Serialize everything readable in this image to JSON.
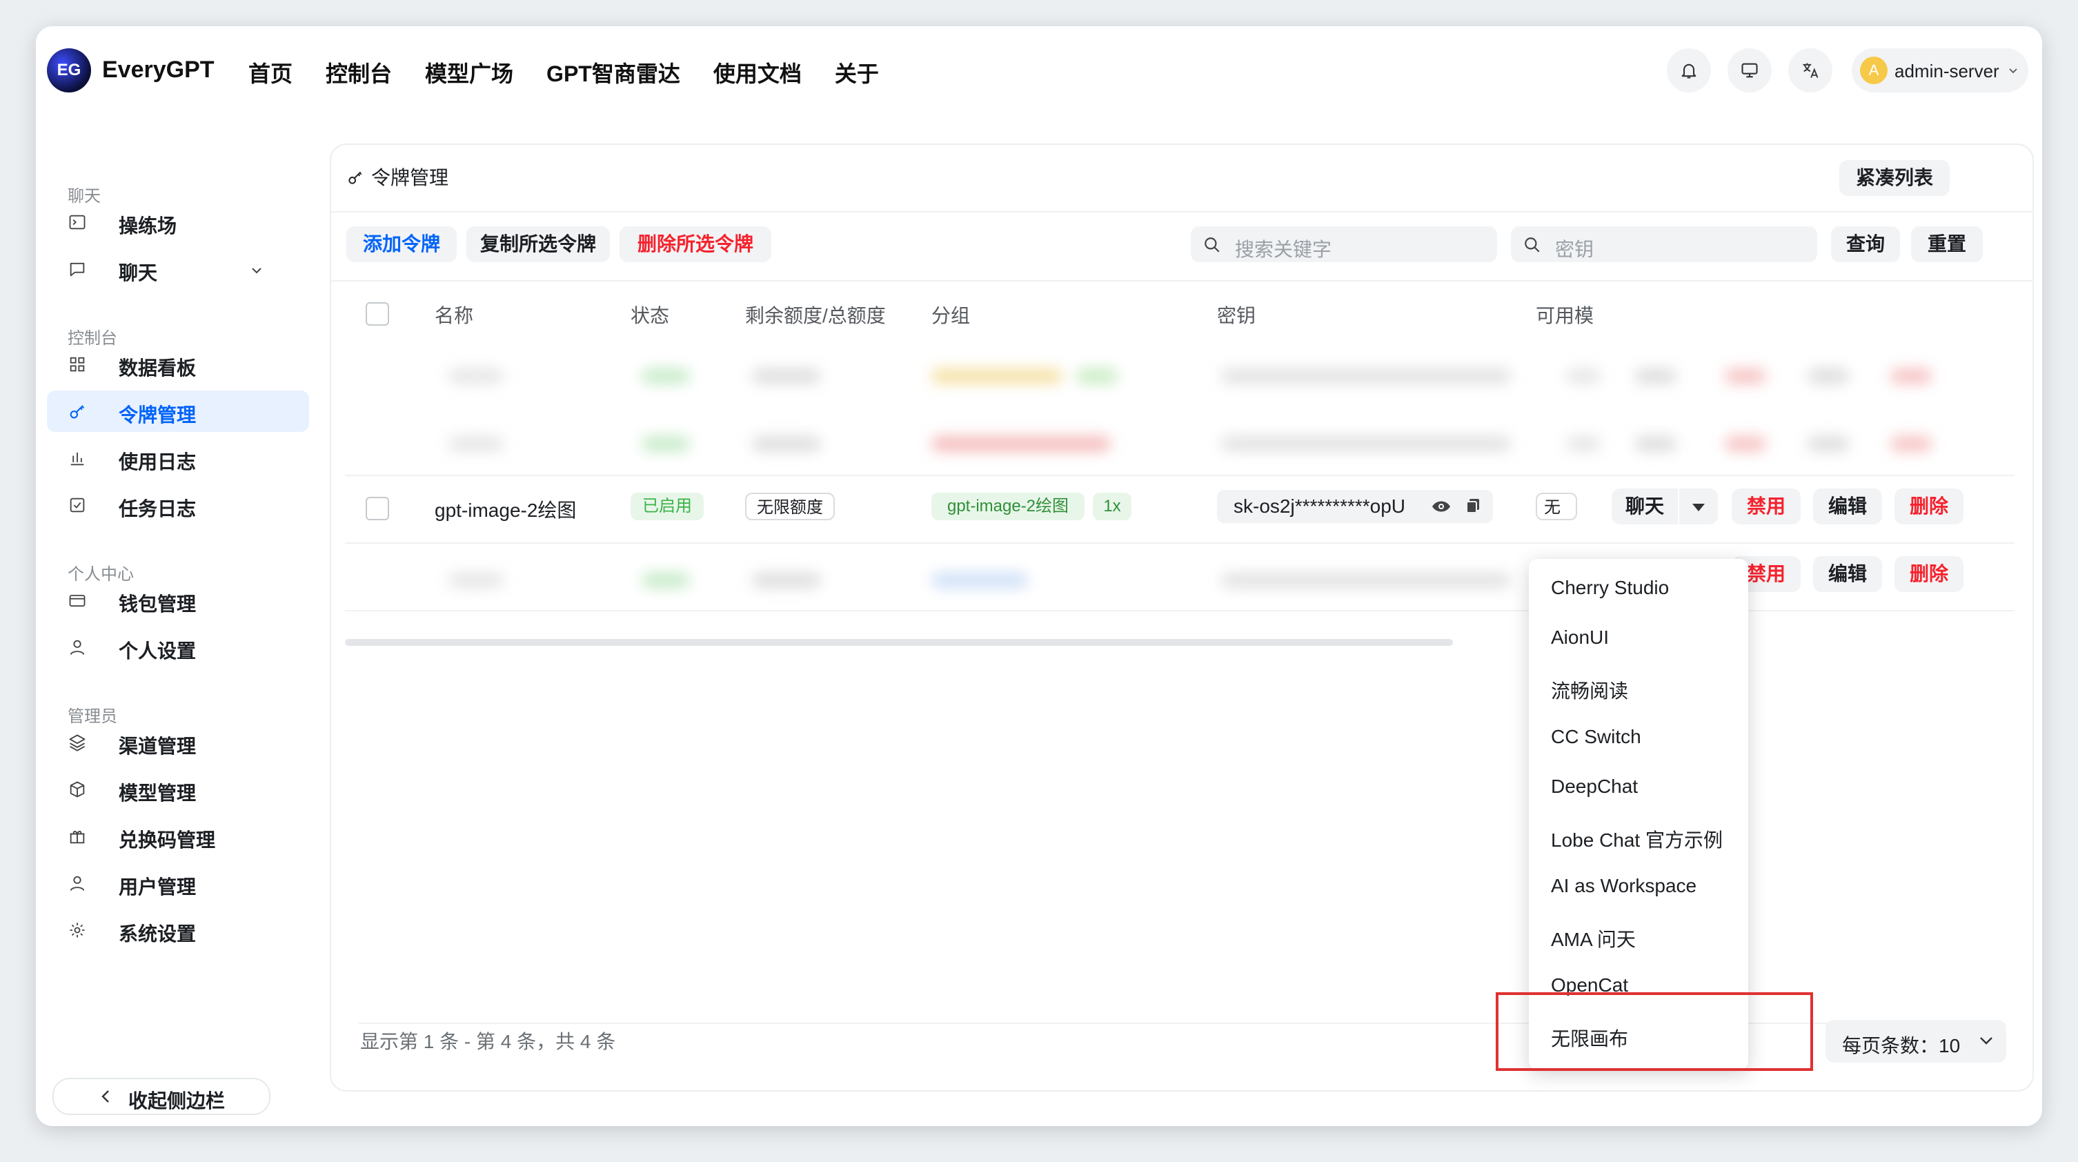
{
  "brand": {
    "logo": "EG",
    "name": "EveryGPT"
  },
  "nav": [
    "首页",
    "控制台",
    "模型广场",
    "GPT智商雷达",
    "使用文档",
    "关于"
  ],
  "header_icons": [
    "bell-icon",
    "monitor-icon",
    "translate-icon"
  ],
  "user": {
    "avatar": "A",
    "name": "admin-server"
  },
  "sidebar": {
    "groups": {
      "chat": "聊天",
      "console": "控制台",
      "personal": "个人中心",
      "admin": "管理员"
    },
    "items": {
      "playground": "操练场",
      "chat": "聊天",
      "dashboard": "数据看板",
      "tokens": "令牌管理",
      "usage_log": "使用日志",
      "task_log": "任务日志",
      "wallet": "钱包管理",
      "settings": "个人设置",
      "channels": "渠道管理",
      "models": "模型管理",
      "redeem": "兑换码管理",
      "users": "用户管理",
      "system": "系统设置"
    },
    "collapse": "收起侧边栏"
  },
  "page": {
    "title": "令牌管理",
    "compact_list": "紧凑列表",
    "add_token": "添加令牌",
    "copy_selected": "复制所选令牌",
    "delete_selected": "删除所选令牌",
    "search_keyword_placeholder": "搜索关键字",
    "search_key_placeholder": "密钥",
    "query": "查询",
    "reset": "重置"
  },
  "table": {
    "columns": [
      "名称",
      "状态",
      "剩余额度/总额度",
      "分组",
      "密钥",
      "可用模"
    ],
    "row": {
      "name": "gpt-image-2绘图",
      "status": "已启用",
      "quota": "无限额度",
      "group": "gpt-image-2绘图",
      "ratio": "1x",
      "key": "sk-os2j**********opU",
      "models": "无限",
      "chat": "聊天",
      "disable": "禁用",
      "edit": "编辑",
      "delete": "删除"
    },
    "row4": {
      "disable": "禁用",
      "edit": "编辑",
      "delete": "删除"
    }
  },
  "pagination": {
    "info": "显示第 1 条 - 第 4 条，共 4 条",
    "page_size": "每页条数：10"
  },
  "chat_dropdown": [
    "Cherry Studio",
    "AionUI",
    "流畅阅读",
    "CC Switch",
    "DeepChat",
    "Lobe Chat 官方示例",
    "AI as Workspace",
    "AMA 问天",
    "OpenCat",
    "无限画布"
  ],
  "colors": {
    "accent": "#0064fa",
    "danger": "#f5222d",
    "success": "#3bb346",
    "highlight_box": "#e03131"
  }
}
